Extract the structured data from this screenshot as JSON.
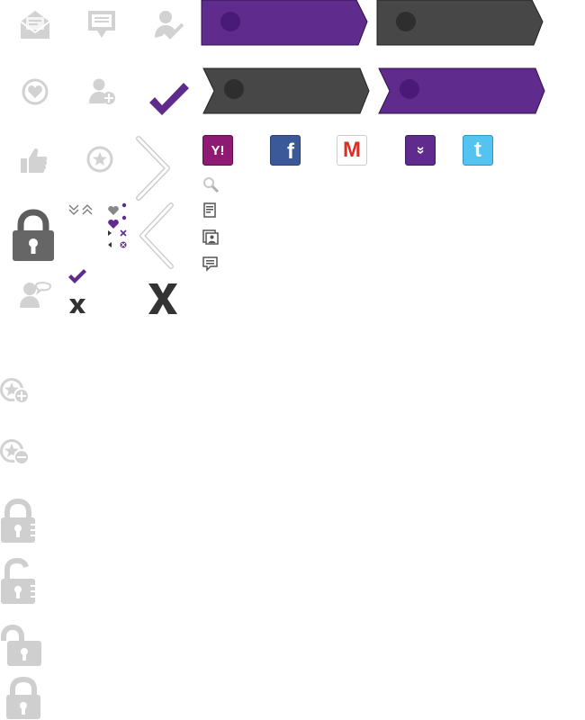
{
  "colors": {
    "purple": "#5f2b8c",
    "purple_light": "#7a3fb0",
    "dark": "#474747",
    "icon_gray": "#d2d2d2",
    "dark_gray": "#4a4a4a",
    "lock_dark": "#666666"
  },
  "icon_sheet": {
    "row1": [
      {
        "name": "envelope-icon"
      },
      {
        "name": "message-icon"
      },
      {
        "name": "user-check-icon"
      }
    ],
    "row2": [
      {
        "name": "heart-circle-icon"
      },
      {
        "name": "user-add-icon"
      },
      {
        "name": "checkmark-icon"
      }
    ],
    "row3": [
      {
        "name": "thumbs-up-icon"
      },
      {
        "name": "star-circle-icon"
      },
      {
        "name": "chevron-right-icon"
      }
    ],
    "row4": [
      {
        "name": "lock-icon"
      },
      {
        "name": "double-chevron-icons"
      },
      {
        "name": "heart-dots-icons"
      },
      {
        "name": "chevron-left-icon"
      }
    ],
    "row5": [
      {
        "name": "user-chat-icon"
      },
      {
        "name": "small-check-x-icon"
      },
      {
        "name": "big-x-icon"
      }
    ]
  },
  "banners": [
    {
      "name": "purple-banner-1",
      "color": "purple"
    },
    {
      "name": "dark-banner-1",
      "color": "dark"
    },
    {
      "name": "dark-banner-2",
      "color": "dark"
    },
    {
      "name": "purple-banner-2",
      "color": "purple"
    }
  ],
  "social": {
    "yahoo": {
      "label": "Y!",
      "color": "#8f1a73"
    },
    "facebook": {
      "label": "f",
      "color": "#3b5998"
    },
    "gmail": {
      "label": "M",
      "color": "#d93025"
    },
    "more": {
      "label": "»",
      "color": "#5f2b8c"
    },
    "twitter": {
      "label": "t",
      "color": "#4fb8e8"
    }
  },
  "small_icons": [
    {
      "name": "search-icon"
    },
    {
      "name": "document-icon"
    },
    {
      "name": "contacts-icon"
    },
    {
      "name": "comment-icon"
    }
  ],
  "lower_icons": [
    {
      "name": "star-plus-icon"
    },
    {
      "name": "star-minus-icon"
    },
    {
      "name": "lock-closed-icon"
    },
    {
      "name": "lock-open-icon"
    },
    {
      "name": "lock-open-alt-icon"
    },
    {
      "name": "lock-closed-alt-icon"
    }
  ]
}
